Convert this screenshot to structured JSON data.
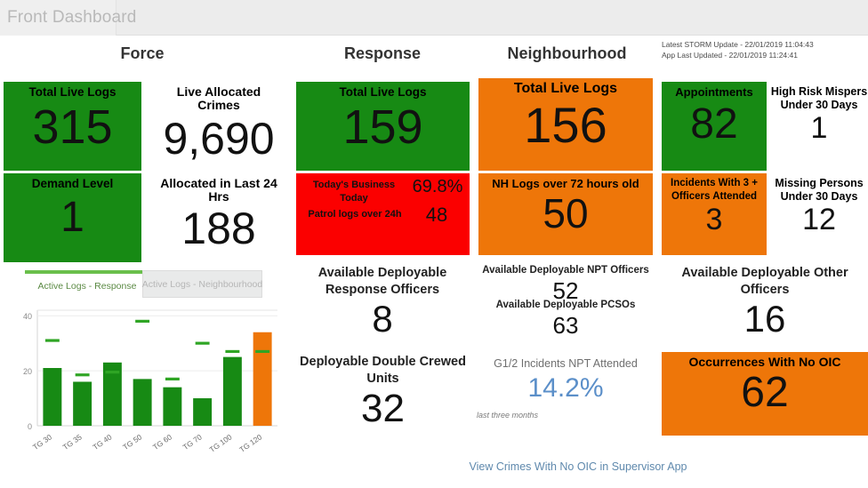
{
  "window": {
    "title": "Front Dashboard"
  },
  "columns": {
    "force": "Force",
    "response": "Response",
    "neighbourhood": "Neighbourhood"
  },
  "stamps": {
    "storm": "Latest STORM Update - 22/01/2019 11:04:43",
    "app": "App Last Updated - 22/01/2019 11:24:41"
  },
  "colors": {
    "green": "#178a14",
    "orange": "#ee7609",
    "red": "#fb0000",
    "link_blue": "#5f89ad",
    "tab_green": "#6abf4b"
  },
  "force": {
    "total_live_logs": {
      "label": "Total Live Logs",
      "value": "315"
    },
    "live_allocated_crimes": {
      "label_line1": "Live Allocated",
      "label_line2": "Crimes",
      "value": "9,690"
    },
    "demand_level": {
      "label": "Demand Level",
      "value": "1"
    },
    "allocated_last_24": {
      "label_line1": "Allocated in Last 24",
      "label_line2": "Hrs",
      "value": "188"
    }
  },
  "response": {
    "total_live_logs": {
      "label": "Total Live Logs",
      "value": "159"
    },
    "business_today": {
      "label_line1": "Today's Business",
      "label_line2": "Today",
      "value": "69.8%",
      "patrol_label": "Patrol logs over 24h",
      "patrol_value": "48"
    },
    "available_response_officers": {
      "label_line1": "Available Deployable",
      "label_line2": "Response Officers",
      "value": "8"
    },
    "double_crewed_units": {
      "label_line1": "Deployable Double Crewed",
      "label_line2": "Units",
      "value": "32"
    }
  },
  "neighbourhood": {
    "total_live_logs": {
      "label": "Total Live Logs",
      "value": "156"
    },
    "nh_logs_72h": {
      "label": "NH Logs over 72 hours old",
      "value": "50"
    },
    "npt_officers": {
      "label": "Available Deployable NPT Officers",
      "value": "52"
    },
    "pcsos": {
      "label": "Available Deployable PCSOs",
      "value": "63"
    },
    "g12_incidents": {
      "label": "G1/2 Incidents NPT Attended",
      "value": "14.2%",
      "sub": "last three months"
    }
  },
  "other": {
    "appointments": {
      "label": "Appointments",
      "value": "82"
    },
    "high_risk_mispers": {
      "label_line1": "High Risk Mispers",
      "label_line2": "Under 30 Days",
      "value": "1"
    },
    "incidents_3plus": {
      "label_line1": "Incidents With 3 +",
      "label_line2": "Officers Attended",
      "value": "3"
    },
    "missing_persons": {
      "label_line1": "Missing Persons",
      "label_line2": "Under 30 Days",
      "value": "12"
    },
    "other_officers": {
      "label_line1": "Available Deployable Other",
      "label_line2": "Officers",
      "value": "16"
    },
    "occurrences_no_oic": {
      "label": "Occurrences With No OIC",
      "value": "62"
    }
  },
  "footer": {
    "link": "View Crimes With No OIC in Supervisor App"
  },
  "tabs": {
    "active": "Active Logs - Response",
    "inactive": "Active Logs - Neighbourhood"
  },
  "chart_data": {
    "type": "bar",
    "title": "",
    "xlabel": "",
    "ylabel": "",
    "ylim": [
      0,
      42
    ],
    "yticks": [
      0,
      20,
      40
    ],
    "ytick_labels": [
      "0",
      "20",
      "40"
    ],
    "grid": true,
    "legend": "none",
    "categories": [
      "TG 30",
      "TG 35",
      "TG 40",
      "TG 50",
      "TG 60",
      "TG 70",
      "TG 100",
      "TG 120"
    ],
    "series": [
      {
        "name": "Active Logs",
        "values": [
          21,
          16,
          23,
          17,
          14,
          10,
          25,
          34
        ],
        "colors": [
          "#178a14",
          "#178a14",
          "#178a14",
          "#178a14",
          "#178a14",
          "#178a14",
          "#178a14",
          "#ee7609"
        ]
      },
      {
        "name": "Target marker",
        "values": [
          31,
          18.5,
          19.5,
          38,
          17,
          30,
          27,
          27
        ],
        "marker": "dash",
        "color": "#2fa524"
      }
    ]
  }
}
